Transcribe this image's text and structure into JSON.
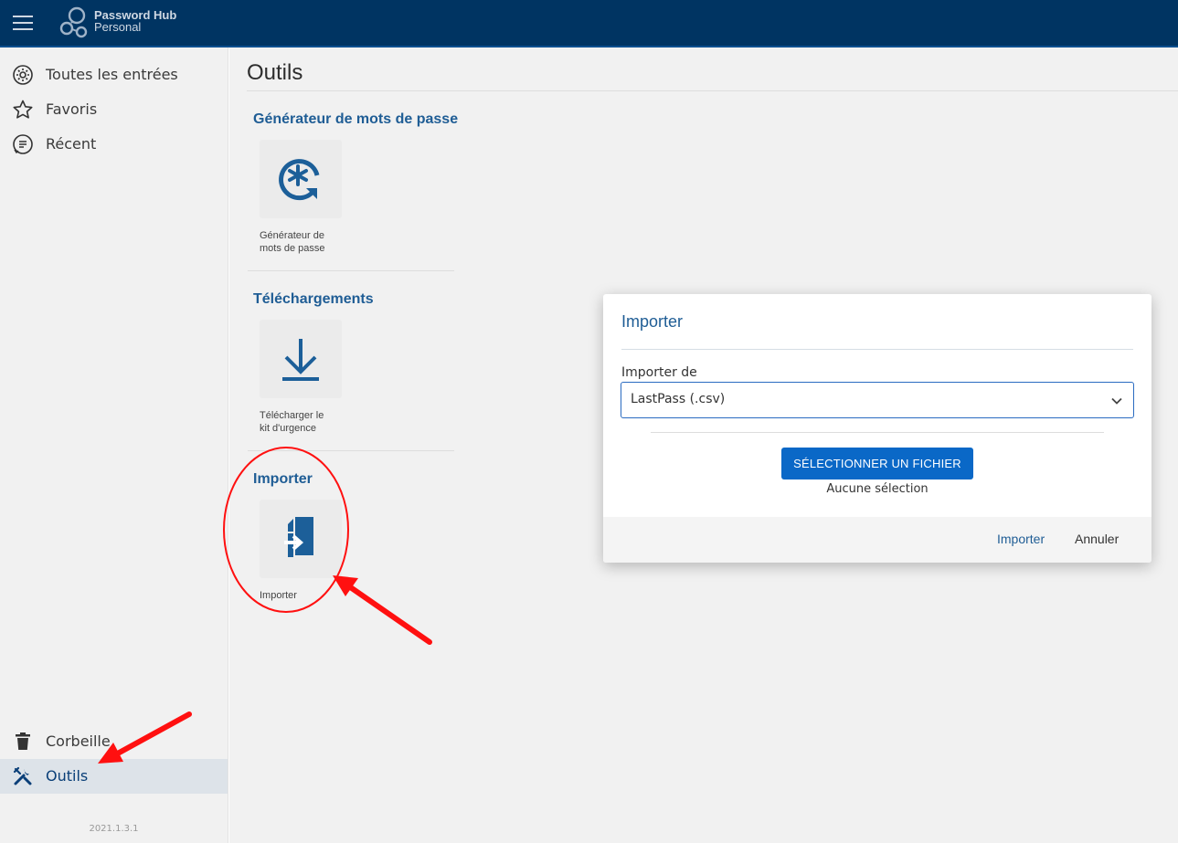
{
  "app": {
    "name_line1": "Password Hub",
    "name_line2": "Personal"
  },
  "sidebar": {
    "items": [
      {
        "label": "Toutes les entrées",
        "icon": "gear-circle-icon"
      },
      {
        "label": "Favoris",
        "icon": "star-icon"
      },
      {
        "label": "Récent",
        "icon": "recent-list-icon"
      }
    ],
    "bottom_items": [
      {
        "label": "Corbeille",
        "icon": "trash-icon"
      },
      {
        "label": "Outils",
        "icon": "tools-icon",
        "active": true
      }
    ],
    "version": "2021.1.3.1"
  },
  "main": {
    "title": "Outils",
    "sections": [
      {
        "title": "Générateur de mots de passe",
        "tool_label_l1": "Générateur de",
        "tool_label_l2": "mots de passe",
        "icon": "password-generator-icon"
      },
      {
        "title": "Téléchargements",
        "tool_label_l1": "Télécharger le",
        "tool_label_l2": "kit d'urgence",
        "icon": "download-icon"
      },
      {
        "title": "Importer",
        "tool_label_l1": "Importer",
        "tool_label_l2": "",
        "icon": "import-icon"
      }
    ]
  },
  "modal": {
    "title": "Importer",
    "field_label": "Importer de",
    "selected_source": "LastPass (.csv)",
    "select_file_label": "SÉLECTIONNER UN FICHIER",
    "file_status": "Aucune sélection",
    "import_label": "Importer",
    "cancel_label": "Annuler"
  },
  "colors": {
    "header_bg": "#003462",
    "accent": "#1f5d95",
    "primary_button": "#0a68c7",
    "annotation_red": "#ff0000"
  }
}
